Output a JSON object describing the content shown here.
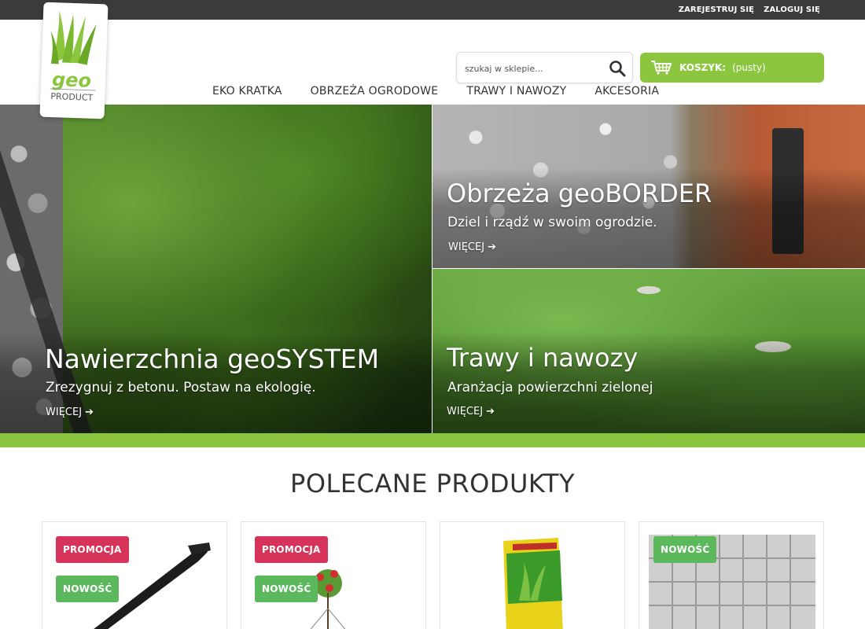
{
  "topbar": {
    "register": "ZAREJESTRUJ SIĘ",
    "login": "ZALOGUJ SIĘ"
  },
  "logo": {
    "word_top": "geo",
    "word_bottom": "PRODUCT"
  },
  "search": {
    "placeholder": "szukaj w sklepie...",
    "icon": "search-icon"
  },
  "cart": {
    "icon": "basket-icon",
    "label": "KOSZYK:",
    "status": "(pusty)"
  },
  "nav": {
    "items": [
      {
        "label": "EKO KRATKA"
      },
      {
        "label": "OBRZEŻA OGRODOWE"
      },
      {
        "label": "TRAWY I NAWOZY"
      },
      {
        "label": "AKCESORIA"
      }
    ]
  },
  "hero": {
    "tiles": [
      {
        "title": "Nawierzchnia geoSYSTEM",
        "subtitle": "Zrezygnuj z betonu. Postaw na ekologię.",
        "more": "WIĘCEJ"
      },
      {
        "title": "Obrzeża geoBORDER",
        "subtitle": "Dziel i rządź w swoim ogrodzie.",
        "more": "WIĘCEJ"
      },
      {
        "title": "Trawy i nawozy",
        "subtitle": "Aranżacja powierzchni zielonej",
        "more": "WIĘCEJ"
      }
    ]
  },
  "featured": {
    "title": "POLECANE PRODUKTY",
    "products": [
      {
        "badges": [
          "PROMOCJA",
          "NOWOŚĆ"
        ]
      },
      {
        "badges": [
          "PROMOCJA",
          "NOWOŚĆ"
        ]
      },
      {
        "badges": []
      },
      {
        "badges": [
          "NOWOŚĆ"
        ]
      }
    ]
  },
  "colors": {
    "accent_green": "#8cc63f",
    "promo_red": "#d6335a",
    "new_green": "#5cb85c",
    "topbar": "#3b3b3b"
  }
}
